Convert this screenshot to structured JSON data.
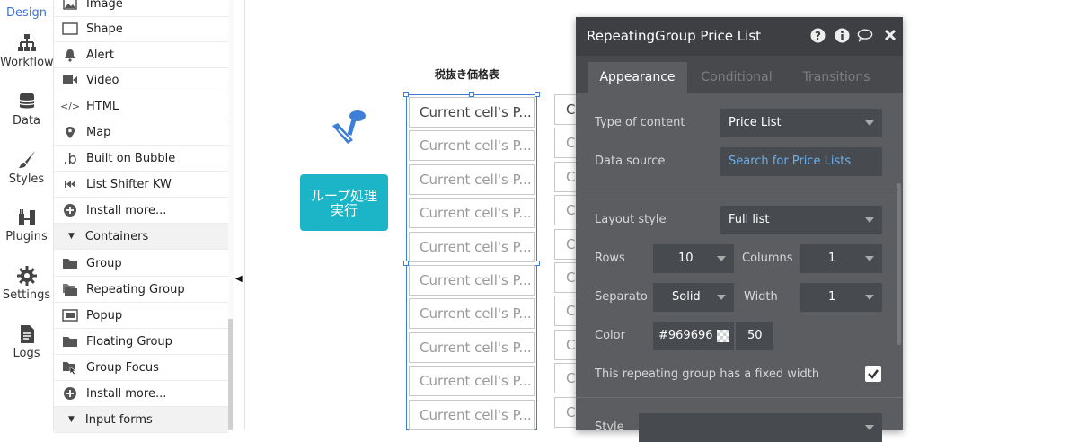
{
  "nav": {
    "design": "Design",
    "workflow": "Workflow",
    "data": "Data",
    "styles": "Styles",
    "plugins": "Plugins",
    "settings": "Settings",
    "logs": "Logs"
  },
  "palette": {
    "items": [
      {
        "label": "Image",
        "icon": "image-icon"
      },
      {
        "label": "Shape",
        "icon": "shape-icon"
      },
      {
        "label": "Alert",
        "icon": "bell-icon"
      },
      {
        "label": "Video",
        "icon": "video-icon"
      },
      {
        "label": "HTML",
        "icon": "code-icon"
      },
      {
        "label": "Map",
        "icon": "map-pin-icon"
      },
      {
        "label": "Built on Bubble",
        "icon": "bubble-b-icon"
      },
      {
        "label": "List Shifter KW",
        "icon": "rewind-icon"
      },
      {
        "label": "Install more...",
        "icon": "plus-circle-icon"
      }
    ],
    "containers_label": "Containers",
    "containers": [
      {
        "label": "Group",
        "icon": "folder-icon"
      },
      {
        "label": "Repeating Group",
        "icon": "folder-stack-icon"
      },
      {
        "label": "Popup",
        "icon": "popup-icon"
      },
      {
        "label": "Floating Group",
        "icon": "floating-folder-icon"
      },
      {
        "label": "Group Focus",
        "icon": "group-focus-icon"
      },
      {
        "label": "Install more...",
        "icon": "plus-circle-icon"
      }
    ],
    "input_forms_label": "Input forms"
  },
  "canvas": {
    "title": "税抜き価格表",
    "button_label": "ループ処理実行",
    "cell_text": "Current cell's P...",
    "cell_text_short": "C",
    "rows": 10
  },
  "editor": {
    "title": "RepeatingGroup Price List",
    "tabs": [
      "Appearance",
      "Conditional",
      "Transitions"
    ],
    "type_of_content_label": "Type of content",
    "type_of_content_value": "Price List",
    "data_source_label": "Data source",
    "data_source_value": "Search for Price Lists",
    "layout_style_label": "Layout style",
    "layout_style_value": "Full list",
    "rows_label": "Rows",
    "rows_value": "10",
    "columns_label": "Columns",
    "columns_value": "1",
    "separator_label": "Separato",
    "separator_value": "Solid",
    "width_label": "Width",
    "width_value": "1",
    "color_label": "Color",
    "color_value": "#969696",
    "opacity_value": "50",
    "fixed_width_label": "This repeating group has a fixed width",
    "style_label": "Style"
  },
  "colors": {
    "accent_blue": "#3b73d6",
    "button_teal": "#1bb5c7",
    "panel_bg": "#5b5d61",
    "panel_header": "#3d3f43",
    "link_blue": "#6ab0f0"
  }
}
